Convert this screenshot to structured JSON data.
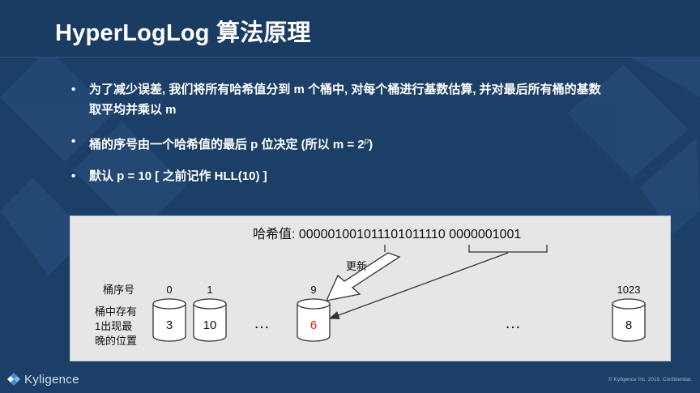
{
  "slide": {
    "title": "HyperLogLog 算法原理",
    "bullets": [
      {
        "line1": "为了减少误差, 我们将所有哈希值分到 m 个桶中, 对每个桶进行基数估算, 并对最后所有桶的基数",
        "line2": "取平均并乘以 m"
      },
      {
        "line1": "桶的序号由一个哈希值的最后 p 位决定 (所以 m = 2",
        "sup": "p",
        "tail": ")"
      },
      {
        "line1": "默认 p = 10 [ 之前记作 HLL(10) ]"
      }
    ]
  },
  "diagram": {
    "hash_label": "哈希值: 000001001011101011110 0000001001",
    "update_label": "更新",
    "bucket_index_label": "桶序号",
    "bucket_value_label_lines": [
      "桶中存有",
      "1出现最",
      "晚的位置"
    ],
    "ellipsis": "…",
    "buckets": [
      {
        "index": "0",
        "value": "3",
        "highlight": false
      },
      {
        "index": "1",
        "value": "10",
        "highlight": false
      },
      {
        "index": "9",
        "value": "6",
        "highlight": true
      },
      {
        "index": "1023",
        "value": "8",
        "highlight": false
      }
    ],
    "highlight_color": "#e0221b"
  },
  "footer": {
    "brand": "Kyligence",
    "copyright": "© Kyligence Inc. 2019. Confidential."
  }
}
